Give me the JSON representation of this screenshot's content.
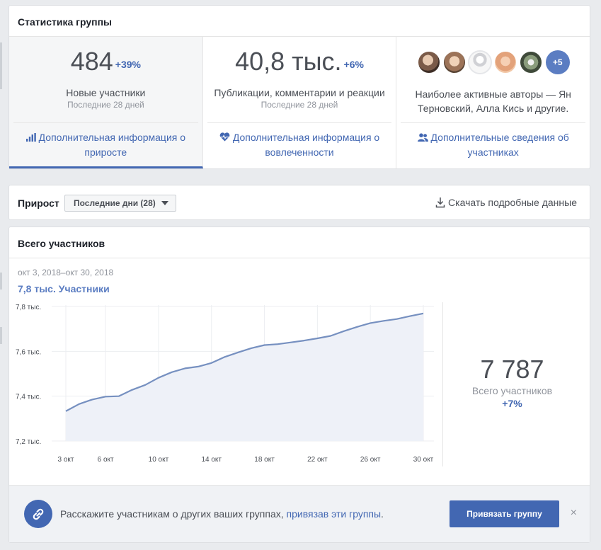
{
  "stats": {
    "title": "Статистика группы",
    "new_members": {
      "value": "484",
      "change": "+39%",
      "label": "Новые участники",
      "period": "Последние 28 дней",
      "link": "Дополнительная информация о приросте"
    },
    "engagement": {
      "value": "40,8 тыс.",
      "change": "+6%",
      "label": "Публикации, комментарии и реакции",
      "period": "Последние 28 дней",
      "link": "Дополнительная информация о вовлеченности"
    },
    "authors": {
      "more_count": "+5",
      "text": "Наиболее активные авторы — Ян Терновский, Алла Кись и другие.",
      "link": "Дополнительные сведения об участниках"
    }
  },
  "growth": {
    "title": "Прирост",
    "range_selected": "Последние дни (28)",
    "download_label": "Скачать подробные данные"
  },
  "members": {
    "title": "Всего участников",
    "date_range": "окт 3, 2018–окт 30, 2018",
    "series_label": "7,8 тыс. Участники",
    "total_value": "7 787",
    "total_label": "Всего участников",
    "total_change": "+7%"
  },
  "footer": {
    "text": "Расскажите участникам о других ваших группах, ",
    "link_text": "привязав эти группы",
    "text_end": ".",
    "button_label": "Привязать группу",
    "close_symbol": "×"
  },
  "icons": {
    "bar_chart": "bar-chart-icon",
    "heart": "heart-pulse-icon",
    "people": "people-icon",
    "download": "download-icon",
    "link": "link-icon",
    "close": "close-icon"
  },
  "colors": {
    "accent": "#4267b2",
    "series_line": "#7690c0",
    "series_fill": "#eef1f8"
  },
  "chart_data": {
    "type": "area",
    "title": "Всего участников",
    "x": [
      "3 окт",
      "4 окт",
      "5 окт",
      "6 окт",
      "7 окт",
      "8 окт",
      "9 окт",
      "10 окт",
      "11 окт",
      "12 окт",
      "13 окт",
      "14 окт",
      "15 окт",
      "16 окт",
      "17 окт",
      "18 окт",
      "19 окт",
      "20 окт",
      "21 окт",
      "22 окт",
      "23 окт",
      "24 окт",
      "25 окт",
      "26 окт",
      "27 окт",
      "28 окт",
      "29 окт",
      "30 окт"
    ],
    "x_tick_labels": [
      "3 окт",
      "6 окт",
      "10 окт",
      "14 окт",
      "18 окт",
      "22 окт",
      "26 окт",
      "30 окт"
    ],
    "series": [
      {
        "name": "Участники",
        "values": [
          7333,
          7365,
          7385,
          7398,
          7400,
          7428,
          7450,
          7482,
          7507,
          7524,
          7532,
          7548,
          7575,
          7595,
          7614,
          7628,
          7632,
          7640,
          7648,
          7658,
          7669,
          7690,
          7709,
          7726,
          7736,
          7744,
          7757,
          7769
        ]
      }
    ],
    "y_tick_labels": [
      "7,8 тыс.",
      "7,6 тыс.",
      "7,4 тыс.",
      "7,2 тыс."
    ],
    "ylim": [
      7200,
      7800
    ],
    "grid": true,
    "legend": "none"
  }
}
